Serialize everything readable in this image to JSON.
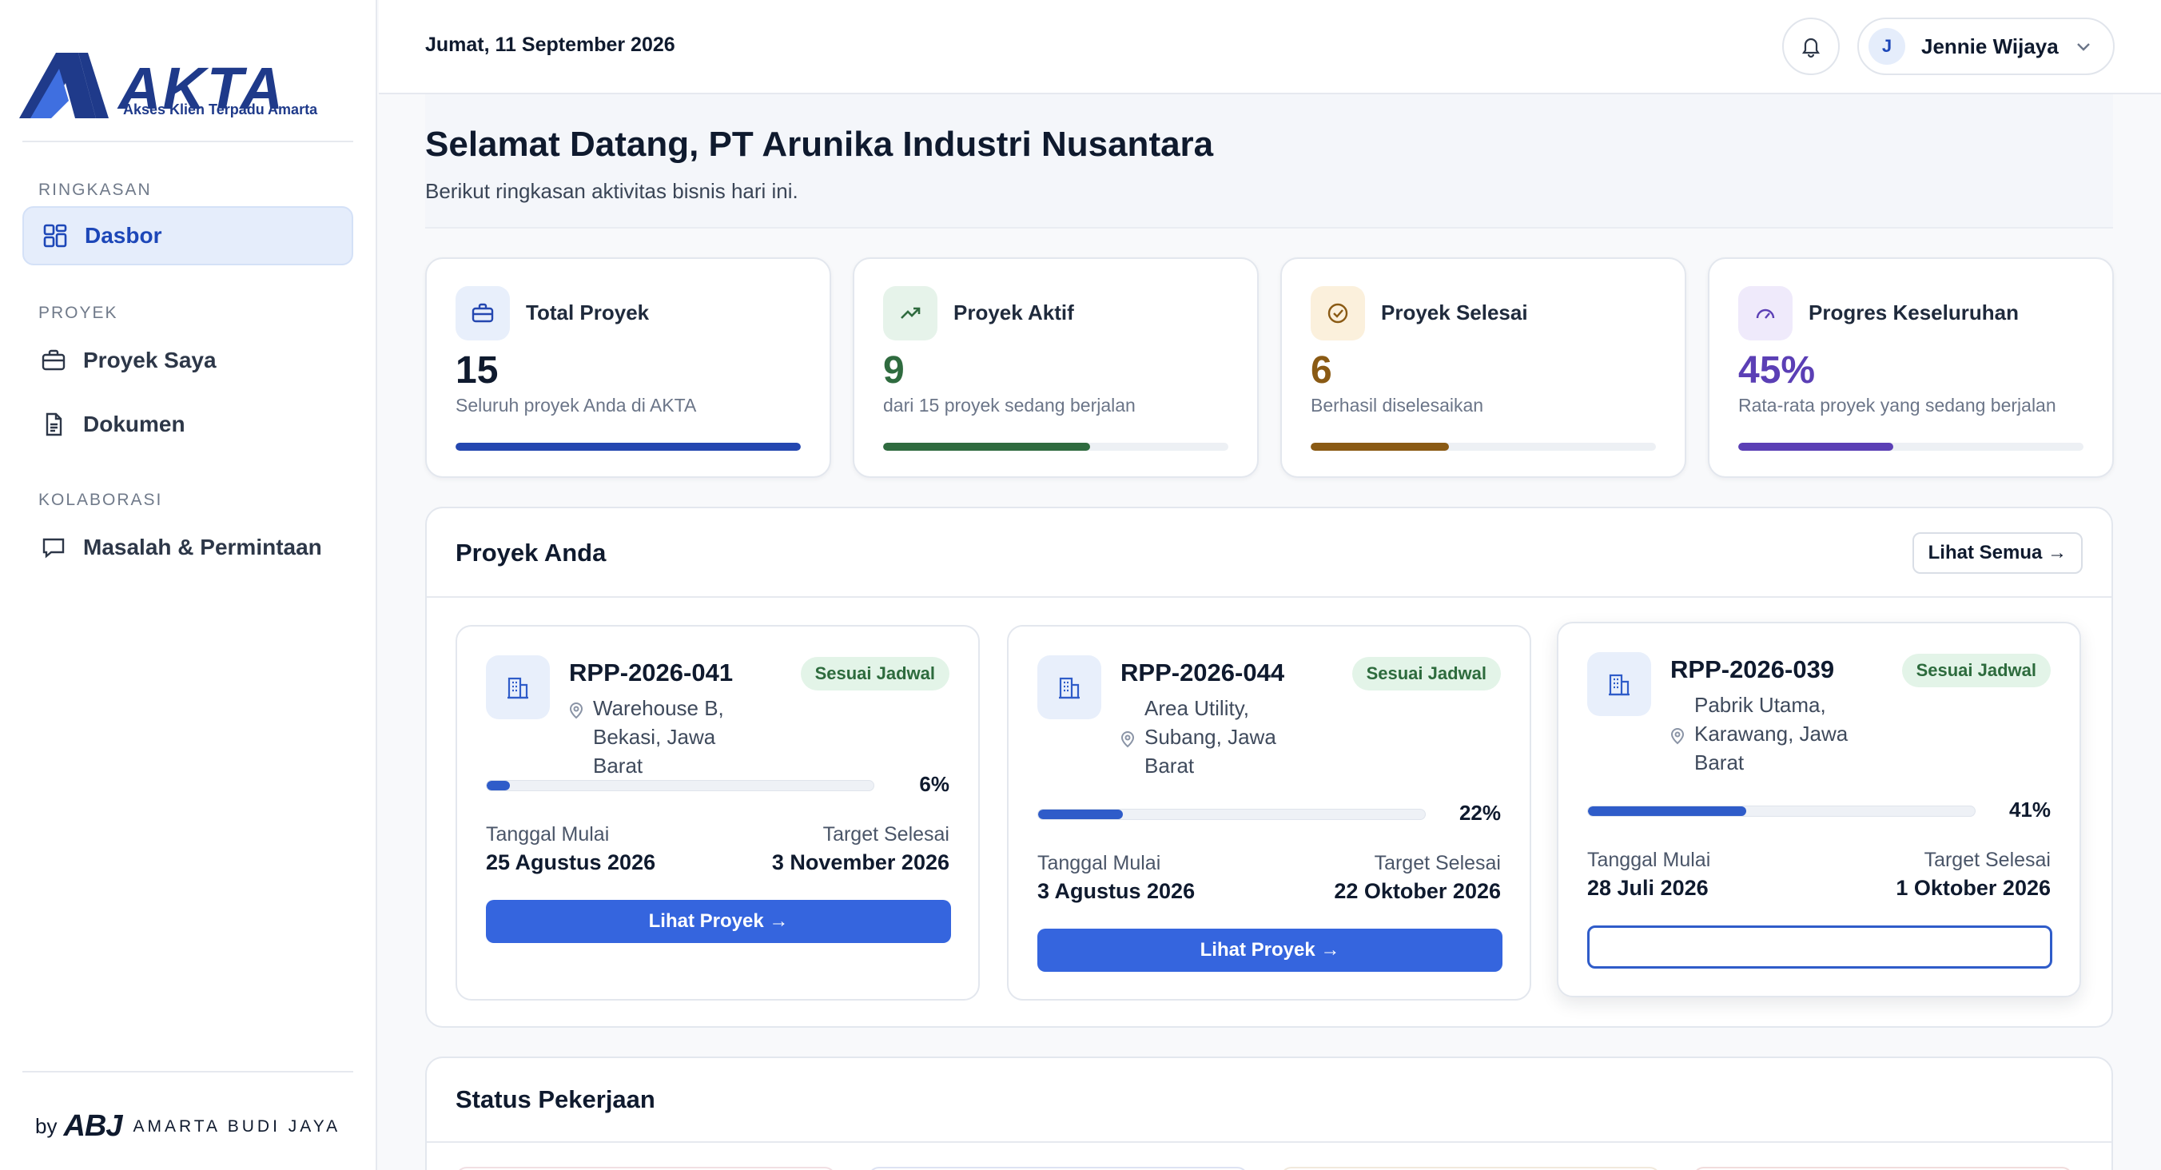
{
  "brand": {
    "name": "AKTA",
    "tagline": "Akses Klien Terpadu Amarta",
    "footer_by": "by",
    "footer_mark": "ABJ",
    "footer_company": "AMARTA BUDI JAYA"
  },
  "sidebar": {
    "sections": [
      {
        "label": "RINGKASAN",
        "items": [
          {
            "label": "Dasbor",
            "icon": "dashboard-grid-icon",
            "active": true
          }
        ]
      },
      {
        "label": "PROYEK",
        "items": [
          {
            "label": "Proyek Saya",
            "icon": "briefcase-icon"
          },
          {
            "label": "Dokumen",
            "icon": "document-icon"
          }
        ]
      },
      {
        "label": "KOLABORASI",
        "items": [
          {
            "label": "Masalah & Permintaan",
            "icon": "chat-icon"
          }
        ]
      }
    ]
  },
  "header": {
    "date": "Jumat, 11 September 2026",
    "user": {
      "initial": "J",
      "name": "Jennie Wijaya"
    }
  },
  "welcome": {
    "title": "Selamat Datang, PT Arunika Industri Nusantara",
    "subtitle": "Berikut ringkasan aktivitas bisnis hari ini."
  },
  "stats": [
    {
      "title": "Total Proyek",
      "value": "15",
      "desc": "Seluruh proyek Anda di AKTA",
      "progress": 1.0,
      "color": "#2447b0",
      "icon_bg": "#e8effb",
      "icon": "briefcase-icon"
    },
    {
      "title": "Proyek Aktif",
      "value": "9",
      "desc": "dari 15 proyek sedang berjalan",
      "progress": 0.6,
      "color": "#2f6b3f",
      "icon_bg": "#e6f3ea",
      "icon": "trending-up-icon"
    },
    {
      "title": "Proyek Selesai",
      "value": "6",
      "desc": "Berhasil diselesaikan",
      "progress": 0.4,
      "color": "#8a5a14",
      "icon_bg": "#fbf0dc",
      "icon": "check-circle-icon"
    },
    {
      "title": "Progres Keseluruhan",
      "value": "45%",
      "desc": "Rata-rata proyek yang sedang berjalan",
      "progress": 0.45,
      "color": "#5b3fb5",
      "icon_bg": "#efeafb",
      "icon": "gauge-icon"
    }
  ],
  "projects": {
    "title": "Proyek Anda",
    "see_all": "Lihat Semua →",
    "start_label": "Tanggal Mulai",
    "target_label": "Target Selesai",
    "items": [
      {
        "id": "RPP-2026-041",
        "status": "Sesuai Jadwal",
        "location": "Warehouse B, Bekasi, Jawa Barat",
        "progress": 0.06,
        "progress_text": "6%",
        "start": "25 Agustus 2026",
        "target": "3 November 2026",
        "button": "Lihat Proyek →"
      },
      {
        "id": "RPP-2026-044",
        "status": "Sesuai Jadwal",
        "location": "Area Utility, Subang, Jawa Barat",
        "progress": 0.22,
        "progress_text": "22%",
        "start": "3 Agustus 2026",
        "target": "22 Oktober 2026",
        "button": "Lihat Proyek →"
      },
      {
        "id": "RPP-2026-039",
        "status": "Sesuai Jadwal",
        "location": "Pabrik Utama, Karawang, Jawa Barat",
        "progress": 0.41,
        "progress_text": "41%",
        "start": "28 Juli 2026",
        "target": "1 Oktober 2026",
        "button": ""
      }
    ]
  },
  "status_panel": {
    "title": "Status Pekerjaan"
  }
}
